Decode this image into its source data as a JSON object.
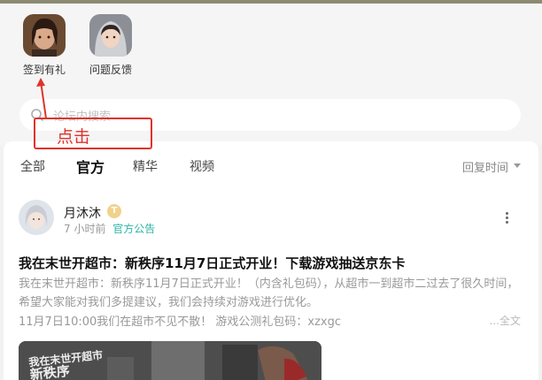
{
  "quick_entries": [
    {
      "label": "签到有礼"
    },
    {
      "label": "问题反馈"
    }
  ],
  "search": {
    "placeholder": "论坛内搜索"
  },
  "tabs": [
    {
      "label": "全部"
    },
    {
      "label": "官方"
    },
    {
      "label": "精华"
    },
    {
      "label": "视频"
    }
  ],
  "sort": {
    "label": "回复时间"
  },
  "post": {
    "author": "月沐沐",
    "badge": "T",
    "time": "7 小时前",
    "tag": "官方公告",
    "title": "我在末世开超市：新秩序11月7日正式开业！下载游戏抽送京东卡",
    "body": "我在末世开超市：新秩序11月7日正式开业！（内含礼包码），从超市一到超市二过去了很久时间，希望大家能对我们多提建议，我们会持续对游戏进行优化。",
    "line3": "11月7日10:00我们在超市不见不散！ 游戏公测礼包码：xzxgc",
    "expand": "...全文",
    "image_logo_line1": "我在末世开超市",
    "image_logo_line2": "新秩序"
  },
  "annotation": {
    "text": "点击",
    "color": "#e0332b"
  },
  "colors": {
    "accent": "#2bb5a5",
    "tab_underline": "#5bd6c9"
  }
}
